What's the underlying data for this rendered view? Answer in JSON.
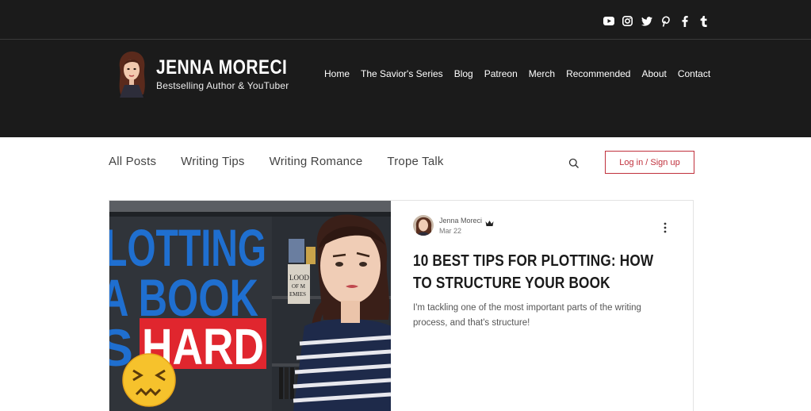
{
  "brand": {
    "name": "JENNA MORECI",
    "tagline": "Bestselling Author & YouTuber"
  },
  "social": [
    "youtube-icon",
    "instagram-icon",
    "twitter-icon",
    "pinterest-icon",
    "facebook-icon",
    "tumblr-icon"
  ],
  "nav": {
    "items": [
      {
        "label": "Home"
      },
      {
        "label": "The Savior's Series"
      },
      {
        "label": "Blog"
      },
      {
        "label": "Patreon"
      },
      {
        "label": "Merch"
      },
      {
        "label": "Recommended"
      },
      {
        "label": "About"
      },
      {
        "label": "Contact"
      }
    ]
  },
  "categories": [
    {
      "label": "All Posts"
    },
    {
      "label": "Writing Tips"
    },
    {
      "label": "Writing Romance"
    },
    {
      "label": "Trope Talk"
    }
  ],
  "auth": {
    "login_label": "Log in / Sign up"
  },
  "post": {
    "author": "Jenna Moreci",
    "date": "Mar 22",
    "title": "10 BEST TIPS FOR PLOTTING: HOW TO STRUCTURE YOUR BOOK",
    "excerpt": "I'm tackling one of the most important parts of the writing process, and that's structure!",
    "thumbnail_text": {
      "line1": "LOTTING",
      "line2": "A BOOK",
      "line3_left": "S",
      "line3_right": "HARD",
      "book_spine": "LOOD\nOF M\nEMIES"
    }
  },
  "colors": {
    "header_bg": "#1b1b1b",
    "accent": "#c0303c",
    "thumb_blue": "#1f6fd0",
    "thumb_red": "#e0262e"
  }
}
